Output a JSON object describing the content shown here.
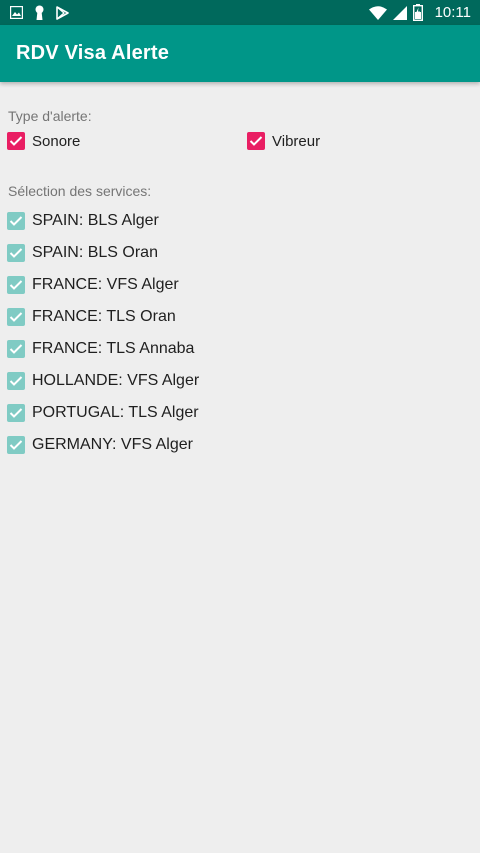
{
  "status_bar": {
    "time": "10:11",
    "left_icons": [
      "image-icon",
      "keyhole-icon",
      "play-store-icon"
    ],
    "right_icons": [
      "wifi-icon",
      "signal-icon",
      "battery-icon"
    ]
  },
  "app_bar": {
    "title": "RDV Visa Alerte",
    "color": "#009688",
    "status_color": "#00695c"
  },
  "alert_type": {
    "label": "Type d'alerte:",
    "options": [
      {
        "label": "Sonore",
        "checked": true
      },
      {
        "label": "Vibreur",
        "checked": true
      }
    ]
  },
  "services": {
    "label": "Sélection des services:",
    "items": [
      {
        "label": "SPAIN: BLS Alger",
        "checked": true
      },
      {
        "label": "SPAIN: BLS Oran",
        "checked": true
      },
      {
        "label": "FRANCE: VFS Alger",
        "checked": true
      },
      {
        "label": "FRANCE: TLS Oran",
        "checked": true
      },
      {
        "label": "FRANCE: TLS Annaba",
        "checked": true
      },
      {
        "label": "HOLLANDE: VFS Alger",
        "checked": true
      },
      {
        "label": "PORTUGAL: TLS Alger",
        "checked": true
      },
      {
        "label": "GERMANY: VFS Alger",
        "checked": true
      }
    ]
  },
  "colors": {
    "accent_pink": "#e91e63",
    "disabled_teal": "#80cbc4",
    "background": "#eeeeee"
  }
}
